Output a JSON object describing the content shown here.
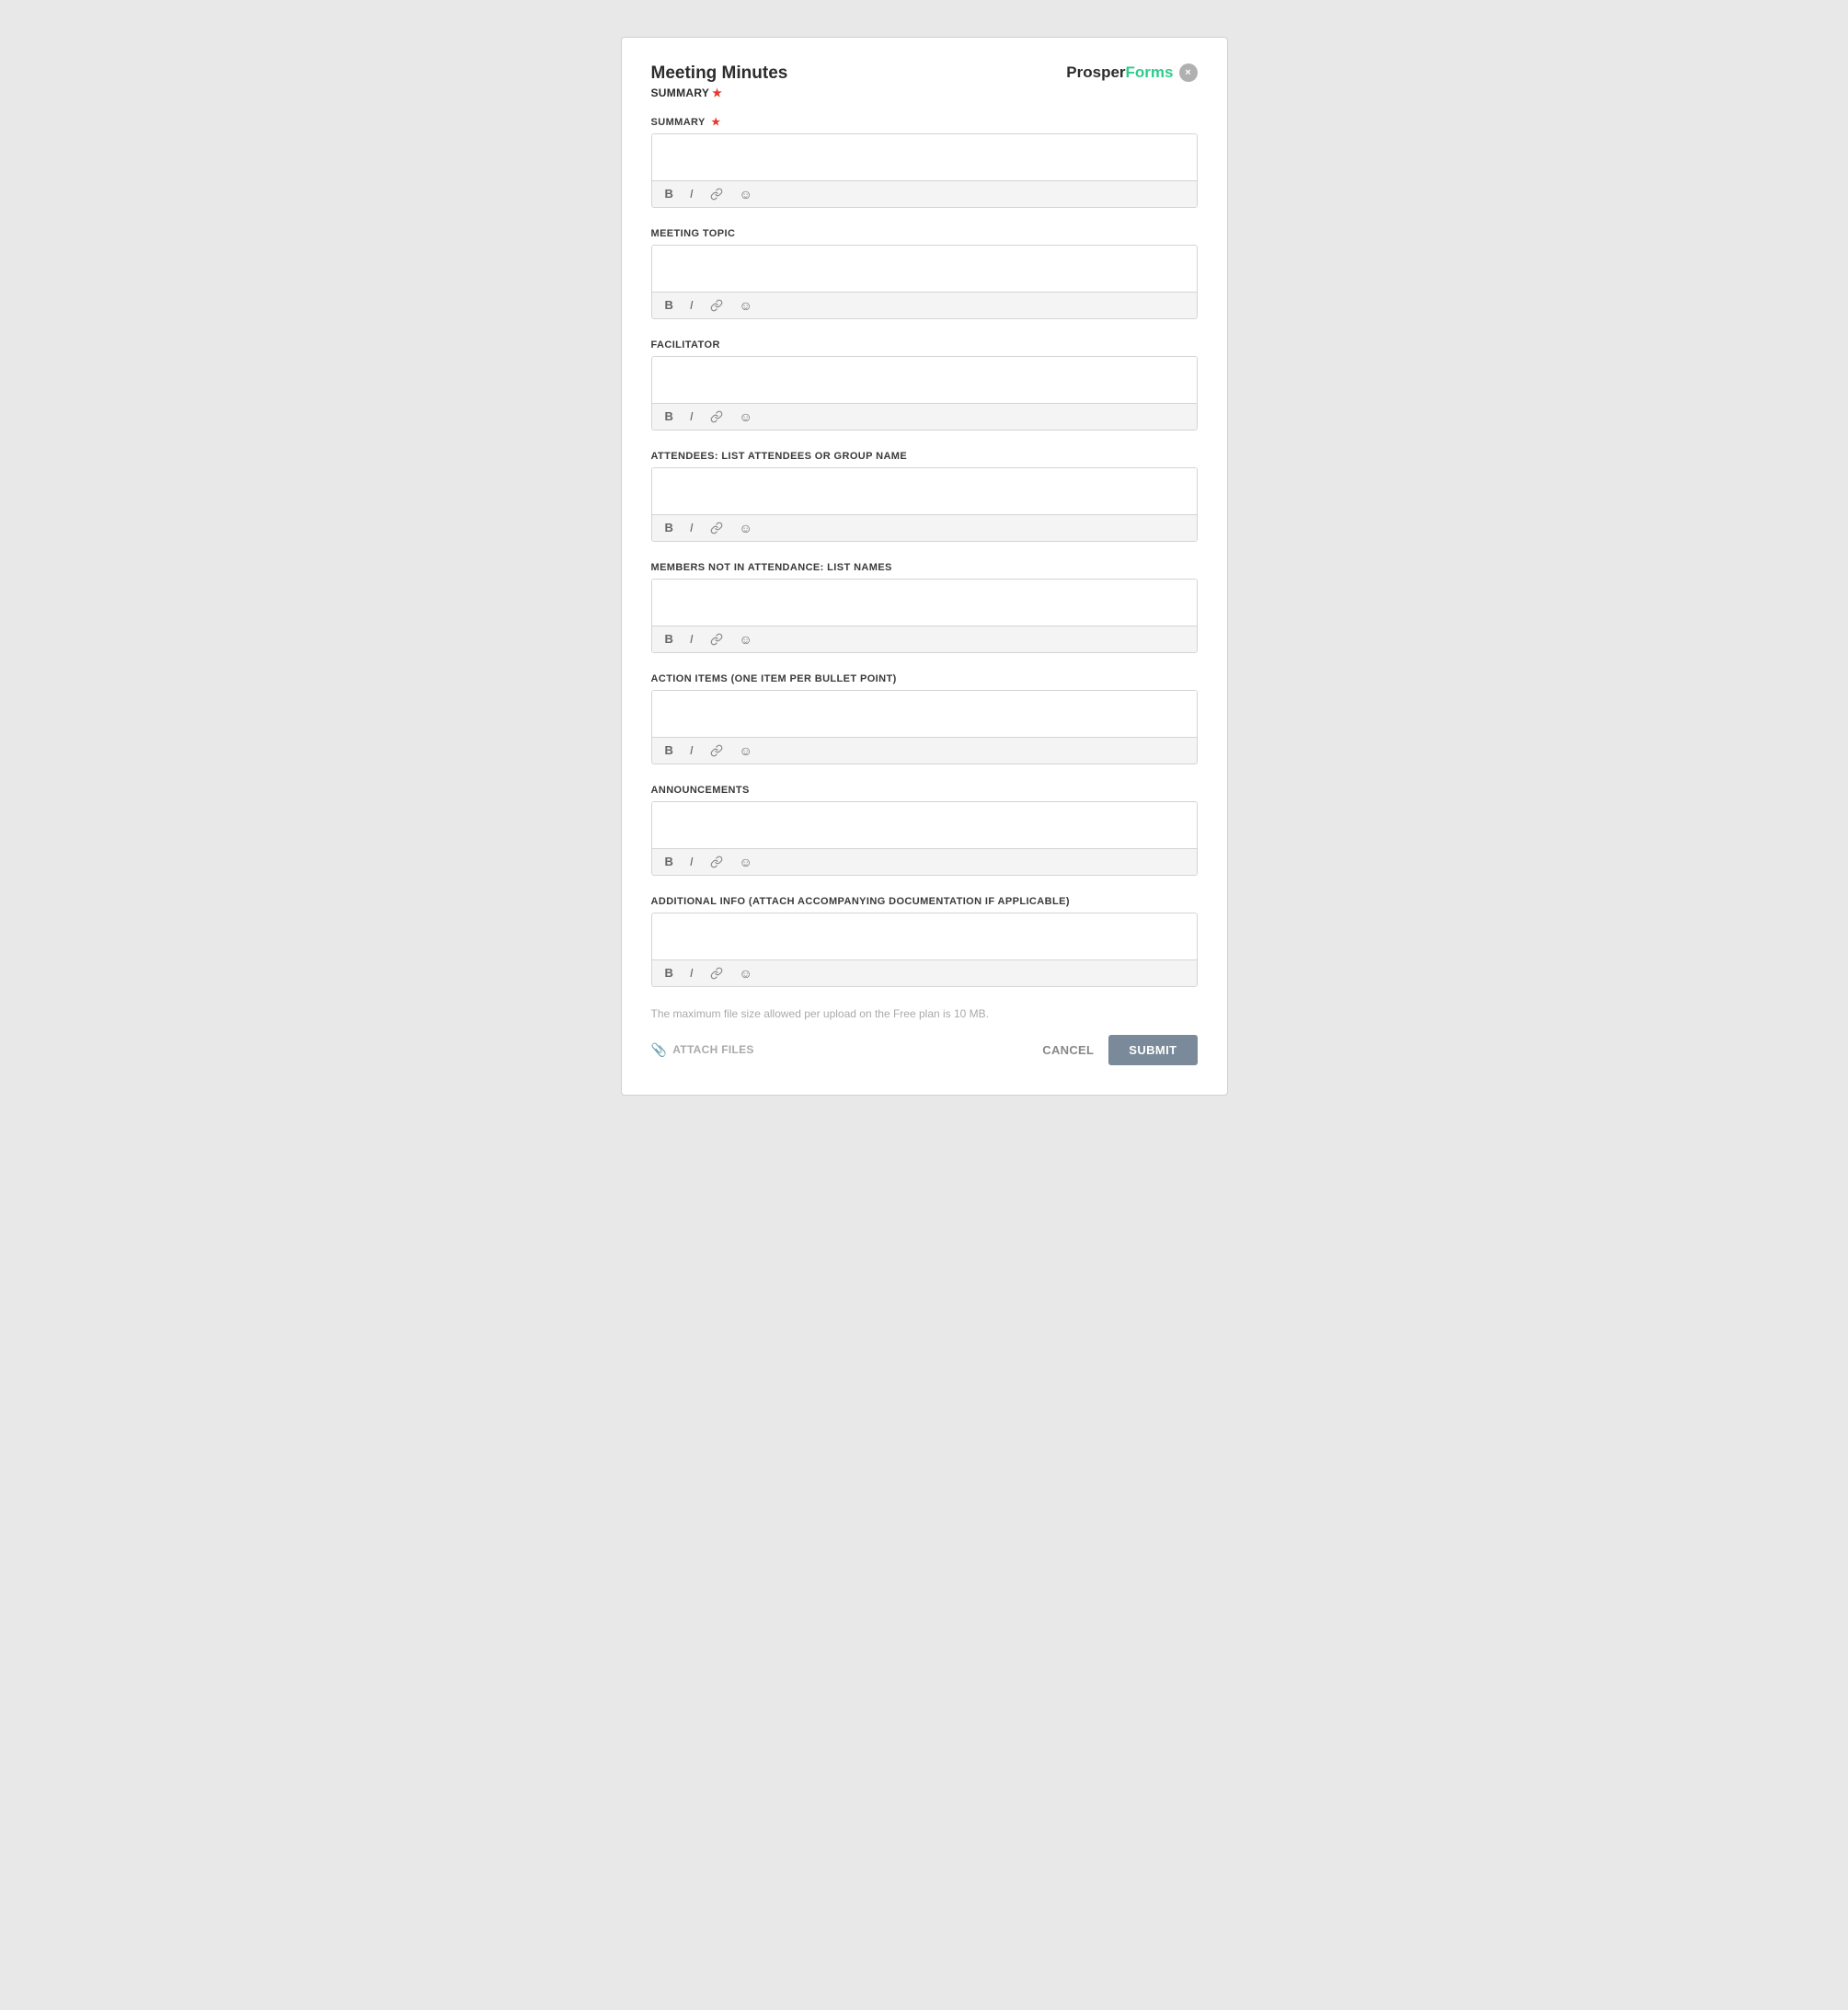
{
  "header": {
    "title": "Meeting Minutes",
    "subtitle": "SUMMARY",
    "required": true,
    "logo_prosper": "Prosper",
    "logo_forms": "Forms",
    "close_label": "×"
  },
  "fields": [
    {
      "id": "summary",
      "label": "SUMMARY",
      "required": true,
      "value": "",
      "toolbar": [
        "B",
        "I",
        "link",
        "emoji"
      ]
    },
    {
      "id": "meeting_topic",
      "label": "MEETING TOPIC",
      "required": false,
      "value": "",
      "toolbar": [
        "B",
        "I",
        "link",
        "emoji"
      ]
    },
    {
      "id": "facilitator",
      "label": "FACILITATOR",
      "required": false,
      "value": "",
      "toolbar": [
        "B",
        "I",
        "link",
        "emoji"
      ]
    },
    {
      "id": "attendees",
      "label": "ATTENDEES: LIST ATTENDEES OR GROUP NAME",
      "required": false,
      "value": "",
      "toolbar": [
        "B",
        "I",
        "link",
        "emoji"
      ]
    },
    {
      "id": "members_not_attending",
      "label": "MEMBERS NOT IN ATTENDANCE: LIST NAMES",
      "required": false,
      "value": "",
      "toolbar": [
        "B",
        "I",
        "link",
        "emoji"
      ]
    },
    {
      "id": "action_items",
      "label": "ACTION ITEMS (ONE ITEM PER BULLET POINT)",
      "required": false,
      "value": "",
      "toolbar": [
        "B",
        "I",
        "link",
        "emoji"
      ]
    },
    {
      "id": "announcements",
      "label": "ANNOUNCEMENTS",
      "required": false,
      "value": "",
      "toolbar": [
        "B",
        "I",
        "link",
        "emoji"
      ]
    },
    {
      "id": "additional_info",
      "label": "ADDITIONAL INFO (ATTACH ACCOMPANYING DOCUMENTATION IF APPLICABLE)",
      "required": false,
      "value": "",
      "toolbar": [
        "B",
        "I",
        "link",
        "emoji"
      ]
    }
  ],
  "footer": {
    "file_size_note": "The maximum file size allowed per upload on the Free plan is 10 MB.",
    "attach_files_label": "ATTACH FILES",
    "cancel_label": "CANCEL",
    "submit_label": "SUBMIT"
  }
}
